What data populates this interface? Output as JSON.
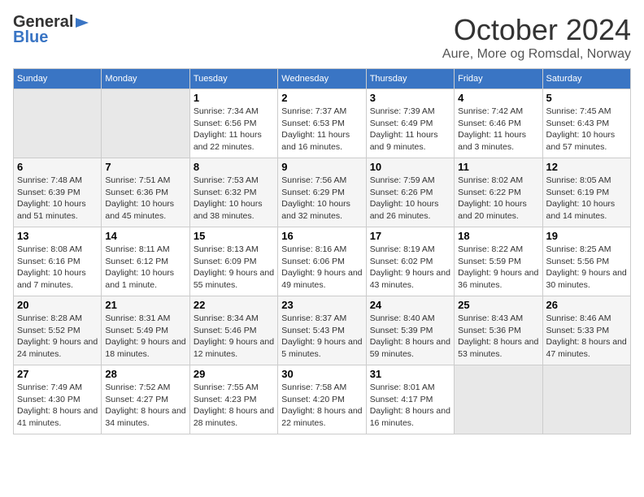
{
  "header": {
    "logo_general": "General",
    "logo_blue": "Blue",
    "month_title": "October 2024",
    "location": "Aure, More og Romsdal, Norway"
  },
  "weekdays": [
    "Sunday",
    "Monday",
    "Tuesday",
    "Wednesday",
    "Thursday",
    "Friday",
    "Saturday"
  ],
  "weeks": [
    [
      {
        "day": "",
        "sunrise": "",
        "sunset": "",
        "daylight": ""
      },
      {
        "day": "",
        "sunrise": "",
        "sunset": "",
        "daylight": ""
      },
      {
        "day": "1",
        "sunrise": "Sunrise: 7:34 AM",
        "sunset": "Sunset: 6:56 PM",
        "daylight": "Daylight: 11 hours and 22 minutes."
      },
      {
        "day": "2",
        "sunrise": "Sunrise: 7:37 AM",
        "sunset": "Sunset: 6:53 PM",
        "daylight": "Daylight: 11 hours and 16 minutes."
      },
      {
        "day": "3",
        "sunrise": "Sunrise: 7:39 AM",
        "sunset": "Sunset: 6:49 PM",
        "daylight": "Daylight: 11 hours and 9 minutes."
      },
      {
        "day": "4",
        "sunrise": "Sunrise: 7:42 AM",
        "sunset": "Sunset: 6:46 PM",
        "daylight": "Daylight: 11 hours and 3 minutes."
      },
      {
        "day": "5",
        "sunrise": "Sunrise: 7:45 AM",
        "sunset": "Sunset: 6:43 PM",
        "daylight": "Daylight: 10 hours and 57 minutes."
      }
    ],
    [
      {
        "day": "6",
        "sunrise": "Sunrise: 7:48 AM",
        "sunset": "Sunset: 6:39 PM",
        "daylight": "Daylight: 10 hours and 51 minutes."
      },
      {
        "day": "7",
        "sunrise": "Sunrise: 7:51 AM",
        "sunset": "Sunset: 6:36 PM",
        "daylight": "Daylight: 10 hours and 45 minutes."
      },
      {
        "day": "8",
        "sunrise": "Sunrise: 7:53 AM",
        "sunset": "Sunset: 6:32 PM",
        "daylight": "Daylight: 10 hours and 38 minutes."
      },
      {
        "day": "9",
        "sunrise": "Sunrise: 7:56 AM",
        "sunset": "Sunset: 6:29 PM",
        "daylight": "Daylight: 10 hours and 32 minutes."
      },
      {
        "day": "10",
        "sunrise": "Sunrise: 7:59 AM",
        "sunset": "Sunset: 6:26 PM",
        "daylight": "Daylight: 10 hours and 26 minutes."
      },
      {
        "day": "11",
        "sunrise": "Sunrise: 8:02 AM",
        "sunset": "Sunset: 6:22 PM",
        "daylight": "Daylight: 10 hours and 20 minutes."
      },
      {
        "day": "12",
        "sunrise": "Sunrise: 8:05 AM",
        "sunset": "Sunset: 6:19 PM",
        "daylight": "Daylight: 10 hours and 14 minutes."
      }
    ],
    [
      {
        "day": "13",
        "sunrise": "Sunrise: 8:08 AM",
        "sunset": "Sunset: 6:16 PM",
        "daylight": "Daylight: 10 hours and 7 minutes."
      },
      {
        "day": "14",
        "sunrise": "Sunrise: 8:11 AM",
        "sunset": "Sunset: 6:12 PM",
        "daylight": "Daylight: 10 hours and 1 minute."
      },
      {
        "day": "15",
        "sunrise": "Sunrise: 8:13 AM",
        "sunset": "Sunset: 6:09 PM",
        "daylight": "Daylight: 9 hours and 55 minutes."
      },
      {
        "day": "16",
        "sunrise": "Sunrise: 8:16 AM",
        "sunset": "Sunset: 6:06 PM",
        "daylight": "Daylight: 9 hours and 49 minutes."
      },
      {
        "day": "17",
        "sunrise": "Sunrise: 8:19 AM",
        "sunset": "Sunset: 6:02 PM",
        "daylight": "Daylight: 9 hours and 43 minutes."
      },
      {
        "day": "18",
        "sunrise": "Sunrise: 8:22 AM",
        "sunset": "Sunset: 5:59 PM",
        "daylight": "Daylight: 9 hours and 36 minutes."
      },
      {
        "day": "19",
        "sunrise": "Sunrise: 8:25 AM",
        "sunset": "Sunset: 5:56 PM",
        "daylight": "Daylight: 9 hours and 30 minutes."
      }
    ],
    [
      {
        "day": "20",
        "sunrise": "Sunrise: 8:28 AM",
        "sunset": "Sunset: 5:52 PM",
        "daylight": "Daylight: 9 hours and 24 minutes."
      },
      {
        "day": "21",
        "sunrise": "Sunrise: 8:31 AM",
        "sunset": "Sunset: 5:49 PM",
        "daylight": "Daylight: 9 hours and 18 minutes."
      },
      {
        "day": "22",
        "sunrise": "Sunrise: 8:34 AM",
        "sunset": "Sunset: 5:46 PM",
        "daylight": "Daylight: 9 hours and 12 minutes."
      },
      {
        "day": "23",
        "sunrise": "Sunrise: 8:37 AM",
        "sunset": "Sunset: 5:43 PM",
        "daylight": "Daylight: 9 hours and 5 minutes."
      },
      {
        "day": "24",
        "sunrise": "Sunrise: 8:40 AM",
        "sunset": "Sunset: 5:39 PM",
        "daylight": "Daylight: 8 hours and 59 minutes."
      },
      {
        "day": "25",
        "sunrise": "Sunrise: 8:43 AM",
        "sunset": "Sunset: 5:36 PM",
        "daylight": "Daylight: 8 hours and 53 minutes."
      },
      {
        "day": "26",
        "sunrise": "Sunrise: 8:46 AM",
        "sunset": "Sunset: 5:33 PM",
        "daylight": "Daylight: 8 hours and 47 minutes."
      }
    ],
    [
      {
        "day": "27",
        "sunrise": "Sunrise: 7:49 AM",
        "sunset": "Sunset: 4:30 PM",
        "daylight": "Daylight: 8 hours and 41 minutes."
      },
      {
        "day": "28",
        "sunrise": "Sunrise: 7:52 AM",
        "sunset": "Sunset: 4:27 PM",
        "daylight": "Daylight: 8 hours and 34 minutes."
      },
      {
        "day": "29",
        "sunrise": "Sunrise: 7:55 AM",
        "sunset": "Sunset: 4:23 PM",
        "daylight": "Daylight: 8 hours and 28 minutes."
      },
      {
        "day": "30",
        "sunrise": "Sunrise: 7:58 AM",
        "sunset": "Sunset: 4:20 PM",
        "daylight": "Daylight: 8 hours and 22 minutes."
      },
      {
        "day": "31",
        "sunrise": "Sunrise: 8:01 AM",
        "sunset": "Sunset: 4:17 PM",
        "daylight": "Daylight: 8 hours and 16 minutes."
      },
      {
        "day": "",
        "sunrise": "",
        "sunset": "",
        "daylight": ""
      },
      {
        "day": "",
        "sunrise": "",
        "sunset": "",
        "daylight": ""
      }
    ]
  ]
}
